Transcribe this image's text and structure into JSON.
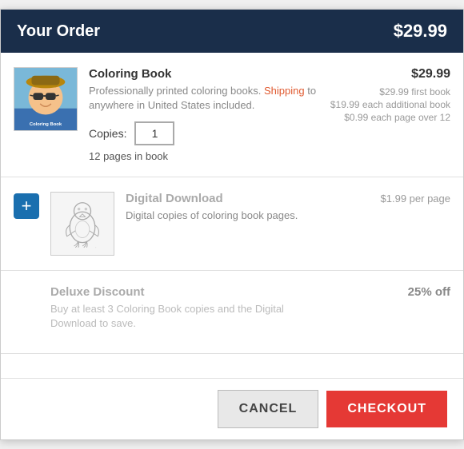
{
  "header": {
    "title": "Your Order",
    "price": "$29.99"
  },
  "coloring_book": {
    "name": "Coloring Book",
    "description_plain": "Professionally printed coloring books.",
    "description_link": "Shipping",
    "description_after": "to anywhere in United States included.",
    "copies_label": "Copies:",
    "copies_value": "1",
    "pages_info": "12 pages in book",
    "price_main": "$29.99",
    "price_details": [
      "$29.99 first book",
      "$19.99 each additional book",
      "$0.99 each page over 12"
    ]
  },
  "digital_download": {
    "name": "Digital Download",
    "description": "Digital copies of coloring book pages.",
    "price_per_page": "$1.99 per page",
    "add_icon": "+"
  },
  "deluxe_discount": {
    "name": "Deluxe Discount",
    "description": "Buy at least 3 Coloring Book copies and the Digital Download to save.",
    "value": "25% off"
  },
  "footer": {
    "cancel_label": "CANCEL",
    "checkout_label": "CHECKOUT"
  }
}
